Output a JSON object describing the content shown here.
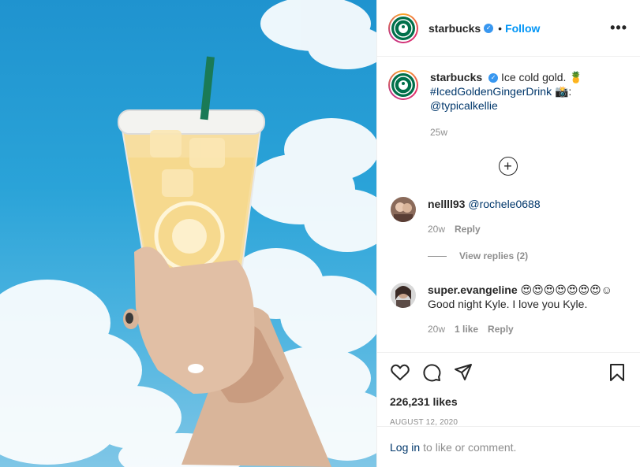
{
  "post": {
    "username": "starbucks",
    "follow_label": "Follow",
    "more_label": "•••"
  },
  "caption": {
    "username": "starbucks",
    "text": "Ice cold gold. 🍍",
    "hashtag": "#IcedGoldenGingerDrink",
    "credit_emoji": "📸:",
    "mention": "@typicalkellie",
    "time": "25w"
  },
  "comments": [
    {
      "username": "nellll93",
      "mention": "@rochele0688",
      "time": "20w",
      "reply_label": "Reply",
      "view_replies": "View replies (2)"
    },
    {
      "username": "super.evangeline",
      "text": "😍😍😍😍😍😍😍☺ Good night Kyle. I love you Kyle.",
      "time": "20w",
      "likes": "1 like",
      "reply_label": "Reply"
    }
  ],
  "engagement": {
    "likes": "226,231 likes",
    "date": "AUGUST 12, 2020"
  },
  "login_bar": {
    "login_label": "Log in",
    "rest": "to like or comment."
  },
  "icons": {
    "like": "heart-icon",
    "comment": "comment-icon",
    "share": "share-icon",
    "save": "bookmark-icon",
    "load_more": "plus-circle-icon"
  },
  "colors": {
    "accent": "#0095f6",
    "verified": "#3897f0",
    "starbucks_green": "#00704a",
    "sky": "#2aa3d8"
  }
}
